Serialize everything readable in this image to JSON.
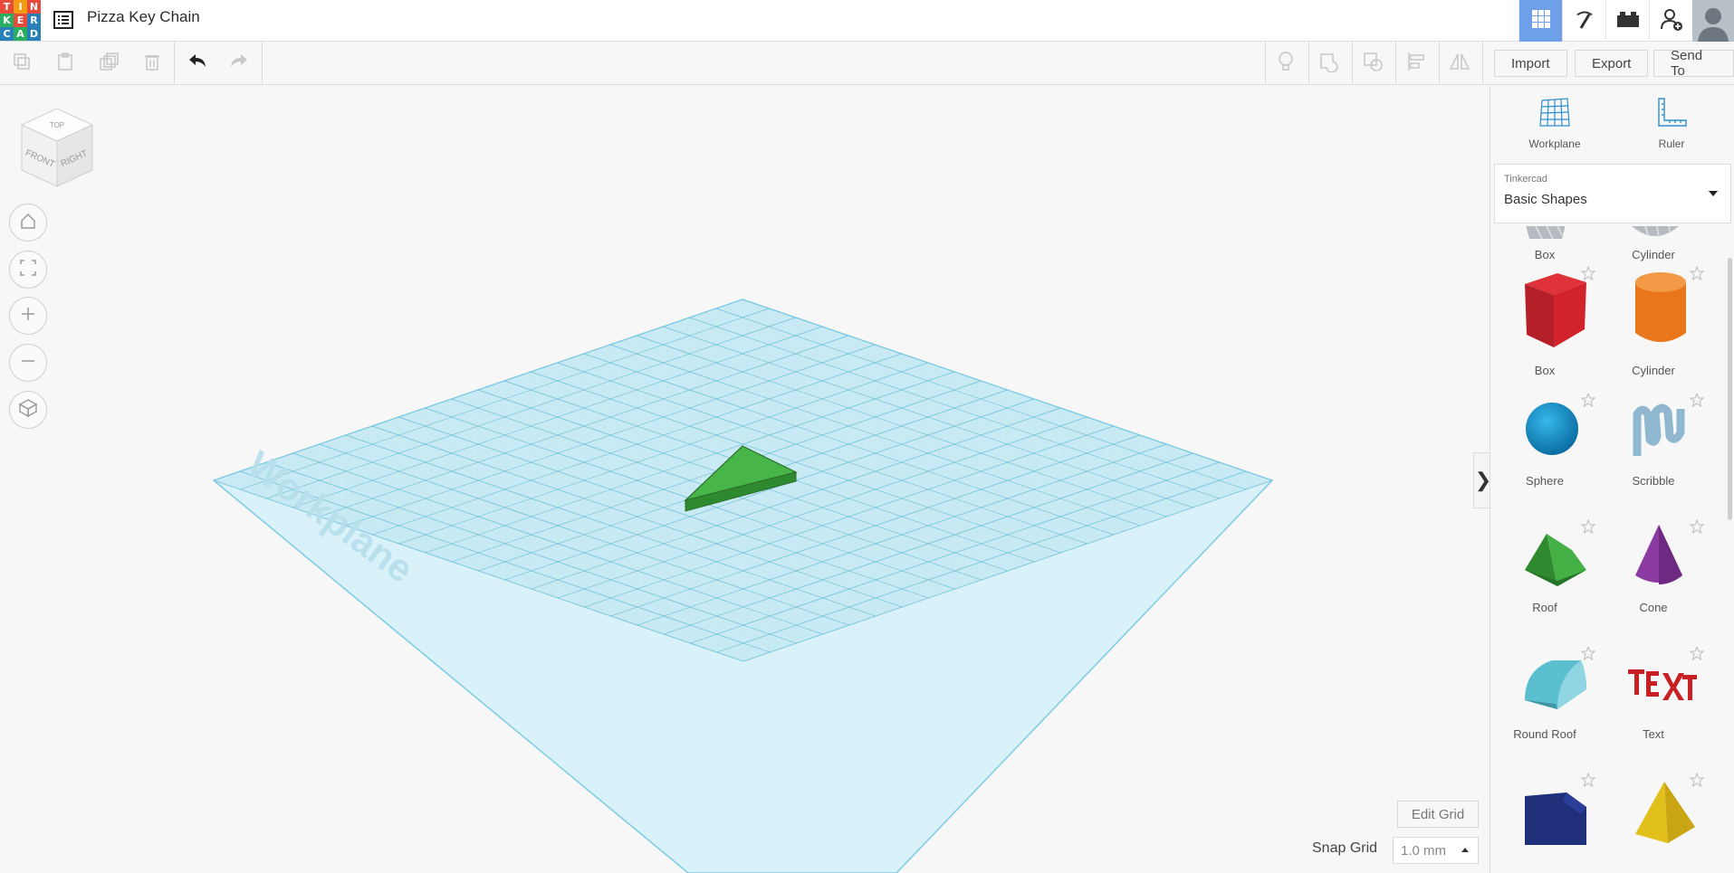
{
  "app": {
    "logo": [
      "T",
      "I",
      "N",
      "K",
      "E",
      "R",
      "C",
      "A",
      "D"
    ],
    "title": "Pizza Key Chain"
  },
  "header": {
    "buttons": [
      {
        "name": "3d-design-view",
        "icon": "grid-icon",
        "active": true
      },
      {
        "name": "codeblocks",
        "icon": "pickaxe-icon"
      },
      {
        "name": "bricks",
        "icon": "brick-icon"
      },
      {
        "name": "invite",
        "icon": "add-user-icon"
      }
    ]
  },
  "toolbar": {
    "import_label": "Import",
    "export_label": "Export",
    "sendto_label": "Send To"
  },
  "workplane": {
    "label": "Workplane",
    "edit_grid_label": "Edit Grid",
    "snap_grid_label": "Snap Grid",
    "snap_value": "1.0 mm"
  },
  "viewcube": {
    "top": "TOP",
    "front": "FRONT",
    "right": "RIGHT"
  },
  "panel": {
    "workplane_label": "Workplane",
    "ruler_label": "Ruler",
    "library_small": "Tinkercad",
    "library_selected": "Basic Shapes",
    "shapes": [
      {
        "label": "Box"
      },
      {
        "label": "Cylinder"
      },
      {
        "label": "Box"
      },
      {
        "label": "Cylinder"
      },
      {
        "label": "Sphere"
      },
      {
        "label": "Scribble"
      },
      {
        "label": "Roof"
      },
      {
        "label": "Cone"
      },
      {
        "label": "Round Roof"
      },
      {
        "label": "Text"
      },
      {
        "label": ""
      },
      {
        "label": ""
      }
    ]
  },
  "colors": {
    "accent": "#6da0e8",
    "grid": "#9fd8ea",
    "shape_green": "#3fae3f",
    "box_red": "#d0232b",
    "cylinder_orange": "#e9761a",
    "sphere_blue": "#1596cf",
    "cone_purple": "#8a3aa0",
    "roundroof_teal": "#5bbfcf"
  }
}
